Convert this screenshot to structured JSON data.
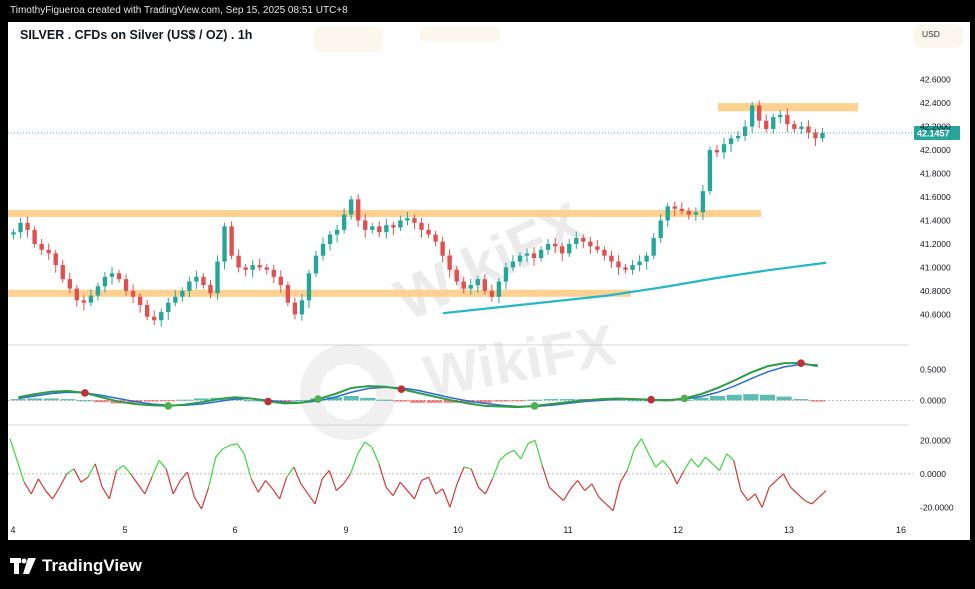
{
  "header": {
    "attribution": "TimothyFigueroa created with TradingView.com, Sep 15, 2025 08:51 UTC+8"
  },
  "footer": {
    "brand": "TradingView"
  },
  "chart_data": [
    {
      "type": "candlestick",
      "title": "SILVER . CFDs on Silver (US$ / OZ) . 1h",
      "currency": "USD",
      "x_labels": [
        "4",
        "5",
        "6",
        "9",
        "10",
        "11",
        "12",
        "13",
        "16"
      ],
      "y_ticks": [
        "42.6000",
        "42.4000",
        "42.2000",
        "42.0000",
        "41.8000",
        "41.6000",
        "41.4000",
        "41.2000",
        "41.0000",
        "40.8000",
        "40.6000"
      ],
      "ylim": [
        40.45,
        42.75
      ],
      "last_price": "42.1457",
      "colors": {
        "up": "#26a69a",
        "down": "#e05050",
        "ma": "#22b8c8",
        "zone": "#ffcf8a"
      },
      "resistance_zones": [
        {
          "from": 42.33,
          "to": 42.4
        },
        {
          "from": 41.43,
          "to": 41.49
        },
        {
          "from": 40.75,
          "to": 40.81
        }
      ],
      "moving_average": [
        40.61,
        40.66,
        40.71,
        40.76,
        40.83,
        40.91,
        40.98,
        41.04
      ],
      "closes": [
        41.3,
        41.38,
        41.32,
        41.2,
        41.15,
        41.12,
        41.02,
        40.9,
        40.82,
        40.72,
        40.7,
        40.76,
        40.84,
        40.92,
        40.95,
        40.9,
        40.8,
        40.75,
        40.68,
        40.58,
        40.55,
        40.62,
        40.7,
        40.75,
        40.8,
        40.88,
        40.92,
        40.85,
        40.78,
        41.05,
        41.35,
        41.1,
        41.0,
        40.98,
        41.02,
        41.0,
        40.98,
        40.92,
        40.85,
        40.7,
        40.6,
        40.72,
        40.95,
        41.1,
        41.2,
        41.28,
        41.32,
        41.45,
        41.58,
        41.4,
        41.32,
        41.35,
        41.3,
        41.36,
        41.34,
        41.4,
        41.42,
        41.38,
        41.32,
        41.28,
        41.22,
        41.1,
        40.98,
        40.88,
        40.82,
        40.85,
        40.9,
        40.8,
        40.75,
        40.88,
        41.0,
        41.05,
        41.1,
        41.12,
        41.08,
        41.15,
        41.2,
        41.18,
        41.12,
        41.2,
        41.25,
        41.22,
        41.18,
        41.15,
        41.1,
        41.05,
        41.0,
        40.98,
        41.02,
        41.05,
        41.1,
        41.25,
        41.4,
        41.52,
        41.5,
        41.48,
        41.45,
        41.47,
        41.65,
        42.0,
        41.98,
        42.05,
        42.1,
        42.12,
        42.2,
        42.38,
        42.25,
        42.18,
        42.28,
        42.3,
        42.22,
        42.18,
        42.2,
        42.15,
        42.1,
        42.1457
      ]
    },
    {
      "type": "line",
      "name": "MACD panel",
      "y_ticks": [
        "0.5000",
        "0.0000"
      ],
      "ylim": [
        -0.35,
        0.78
      ],
      "macd": [
        0.05,
        0.1,
        0.14,
        0.15,
        0.12,
        0.05,
        -0.02,
        -0.06,
        -0.08,
        -0.09,
        -0.07,
        -0.03,
        0.02,
        0.05,
        0.03,
        -0.02,
        -0.05,
        -0.04,
        0.02,
        0.1,
        0.2,
        0.23,
        0.22,
        0.18,
        0.12,
        0.06,
        0.0,
        -0.05,
        -0.09,
        -0.1,
        -0.11,
        -0.09,
        -0.06,
        -0.03,
        0.0,
        0.02,
        0.03,
        0.02,
        0.01,
        0.0,
        0.03,
        0.1,
        0.2,
        0.32,
        0.45,
        0.55,
        0.6,
        0.6,
        0.55
      ],
      "signal": [
        0.03,
        0.07,
        0.11,
        0.13,
        0.12,
        0.08,
        0.03,
        -0.02,
        -0.06,
        -0.08,
        -0.08,
        -0.06,
        -0.02,
        0.02,
        0.03,
        0.0,
        -0.03,
        -0.04,
        -0.01,
        0.05,
        0.13,
        0.19,
        0.21,
        0.2,
        0.16,
        0.1,
        0.04,
        -0.01,
        -0.05,
        -0.08,
        -0.1,
        -0.1,
        -0.08,
        -0.05,
        -0.02,
        0.0,
        0.02,
        0.02,
        0.01,
        0.01,
        0.02,
        0.06,
        0.13,
        0.23,
        0.35,
        0.46,
        0.54,
        0.58,
        0.57
      ],
      "histogram": [
        0.02,
        0.03,
        0.03,
        0.02,
        0.0,
        -0.03,
        -0.05,
        -0.04,
        -0.02,
        -0.01,
        0.01,
        0.03,
        0.04,
        0.03,
        0.0,
        -0.02,
        -0.02,
        0.0,
        0.03,
        0.05,
        0.07,
        0.04,
        0.01,
        -0.02,
        -0.04,
        -0.04,
        -0.04,
        -0.04,
        -0.04,
        -0.02,
        -0.01,
        0.01,
        0.02,
        0.02,
        0.02,
        0.02,
        0.01,
        0.0,
        0.0,
        -0.01,
        0.01,
        0.04,
        0.07,
        0.09,
        0.1,
        0.09,
        0.06,
        0.02,
        -0.02
      ],
      "cross_markers": [
        {
          "index": 4,
          "color": "#c0303a"
        },
        {
          "index": 9,
          "color": "#4caf50"
        },
        {
          "index": 15,
          "color": "#c0303a"
        },
        {
          "index": 18,
          "color": "#4caf50"
        },
        {
          "index": 23,
          "color": "#c0303a"
        },
        {
          "index": 31,
          "color": "#4caf50"
        },
        {
          "index": 38,
          "color": "#c0303a"
        },
        {
          "index": 40,
          "color": "#4caf50"
        },
        {
          "index": 47,
          "color": "#c0303a"
        }
      ],
      "colors": {
        "macd": "#2e9d46",
        "signal": "#2b6bd6",
        "macd_dark": "#a3111e"
      }
    },
    {
      "type": "line",
      "name": "Oscillator panel",
      "y_ticks": [
        "20.0000",
        "0.0000",
        "-20.0000"
      ],
      "ylim": [
        -24,
        25
      ],
      "values": [
        21,
        8,
        -5,
        -12,
        -3,
        -10,
        -15,
        -8,
        0,
        3,
        -5,
        -2,
        6,
        -8,
        -15,
        2,
        5,
        0,
        -6,
        -12,
        -2,
        8,
        3,
        -12,
        -4,
        1,
        -14,
        -21,
        -8,
        10,
        15,
        17,
        18,
        12,
        -3,
        -11,
        -4,
        -9,
        -15,
        -2,
        4,
        -6,
        -12,
        -18,
        -3,
        2,
        -10,
        -6,
        0,
        12,
        19,
        16,
        6,
        -8,
        -13,
        -5,
        -10,
        -15,
        -4,
        -2,
        -12,
        -9,
        -20,
        -6,
        4,
        3,
        -8,
        -12,
        -3,
        8,
        12,
        14,
        9,
        18,
        20,
        5,
        -8,
        -12,
        -16,
        -9,
        -4,
        -10,
        -6,
        -14,
        -18,
        -22,
        -5,
        2,
        15,
        21,
        12,
        4,
        8,
        3,
        -6,
        2,
        9,
        4,
        10,
        6,
        2,
        12,
        8,
        -10,
        -16,
        -12,
        -20,
        -8,
        -4,
        0,
        -8,
        -12,
        -16,
        -18,
        -14,
        -10
      ],
      "colors": {
        "above": "#3bd63b",
        "below": "#d23a3a"
      }
    }
  ]
}
